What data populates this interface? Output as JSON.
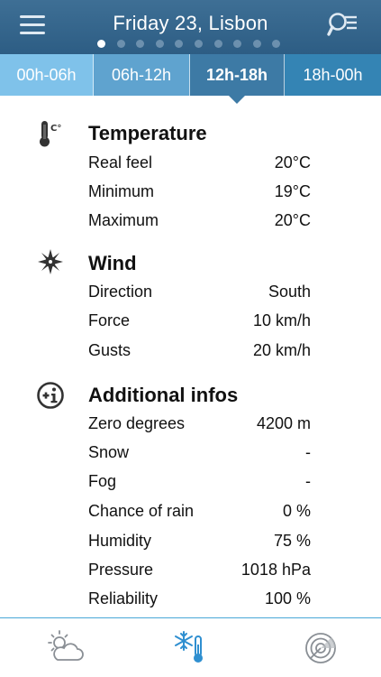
{
  "header": {
    "title": "Friday 23, Lisbon",
    "page_count": 10,
    "active_page": 0
  },
  "tabs": [
    {
      "label": "00h-06h",
      "selected": false
    },
    {
      "label": "06h-12h",
      "selected": false
    },
    {
      "label": "12h-18h",
      "selected": true
    },
    {
      "label": "18h-00h",
      "selected": false
    }
  ],
  "temperature": {
    "title": "Temperature",
    "icon": "thermometer-celsius-icon",
    "rows": [
      {
        "label": "Real feel",
        "value": "20°C"
      },
      {
        "label": "Minimum",
        "value": "19°C"
      },
      {
        "label": "Maximum",
        "value": "20°C"
      }
    ]
  },
  "wind": {
    "title": "Wind",
    "icon": "compass-rose-icon",
    "rows": [
      {
        "label": "Direction",
        "value": "South"
      },
      {
        "label": "Force",
        "value": "10 km/h"
      },
      {
        "label": "Gusts",
        "value": "20 km/h"
      }
    ]
  },
  "additional": {
    "title": "Additional infos",
    "icon": "info-plus-icon",
    "rows": [
      {
        "label": "Zero degrees",
        "value": "4200 m"
      },
      {
        "label": "Snow",
        "value": "-"
      },
      {
        "label": "Fog",
        "value": "-"
      },
      {
        "label": "Chance of rain",
        "value": "0 %"
      },
      {
        "label": "Humidity",
        "value": "75 %"
      },
      {
        "label": "Pressure",
        "value": "1018 hPa"
      },
      {
        "label": "Reliability",
        "value": "100 %"
      }
    ]
  },
  "bottom_nav": [
    {
      "icon": "sun-cloud-icon",
      "active": false
    },
    {
      "icon": "snowflake-thermometer-icon",
      "active": true
    },
    {
      "icon": "radar-icon",
      "active": false
    }
  ],
  "colors": {
    "header": "#2d5d84",
    "accent": "#4aa8d8",
    "active_tab": "#3d7aa5"
  }
}
